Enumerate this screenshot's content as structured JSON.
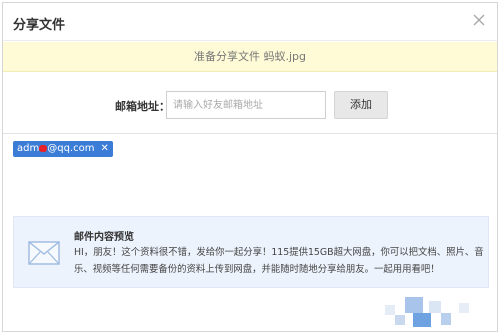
{
  "dialog": {
    "title": "分享文件",
    "close_icon": "close-icon"
  },
  "banner": {
    "text": "准备分享文件 蚂蚁.jpg"
  },
  "form": {
    "label": "邮箱地址：",
    "placeholder": "请输入好友邮箱地址",
    "value": "",
    "add_label": "添加"
  },
  "tags": [
    {
      "text": "adm■@qq.com",
      "remove_icon": "close-icon"
    }
  ],
  "preview": {
    "icon": "mail-envelope-icon",
    "title": "邮件内容预览",
    "body": "HI，朋友！这个资料很不错，发给你一起分享！115提供15GB超大网盘，你可以把文档、照片、音乐、视频等任何需要备份的资料上传到网盘，并能随时随地分享给朋友。一起用用看吧！"
  },
  "colors": {
    "banner_bg": "#fffbd7",
    "tag_bg": "#3b7cd6",
    "preview_bg": "#edf3fc",
    "redaction": "#e8202a"
  }
}
